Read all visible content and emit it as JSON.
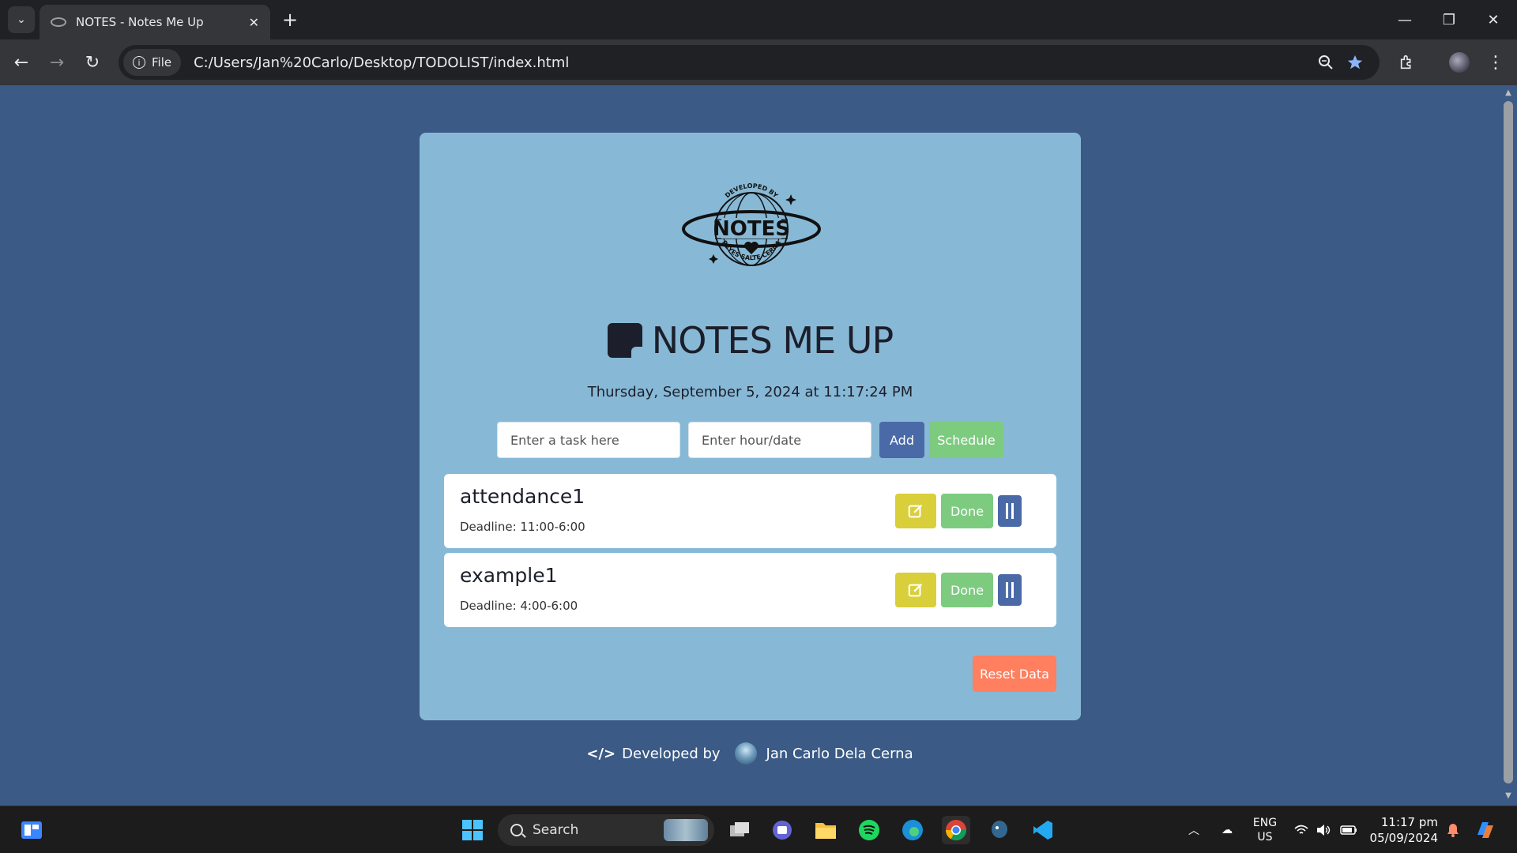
{
  "browser": {
    "tab_title": "NOTES - Notes Me Up",
    "tab_close": "✕",
    "new_tab": "+",
    "chip_label": "File",
    "url": "C:/Users/Jan%20Carlo/Desktop/TODOLIST/index.html"
  },
  "window_controls": {
    "minimize": "—",
    "restore": "❐",
    "close": "✕"
  },
  "nav": {
    "back": "←",
    "forward": "→",
    "reload": "↻"
  },
  "app": {
    "title": "NOTES ME UP",
    "datetime": "Thursday, September 5, 2024 at 11:17:24 PM",
    "task_placeholder": "Enter a task here",
    "date_placeholder": "Enter hour/date",
    "add_label": "Add",
    "schedule_label": "Schedule",
    "tasks": [
      {
        "name": "attendance1",
        "deadline": "Deadline: 11:00-6:00",
        "done_label": "Done"
      },
      {
        "name": "example1",
        "deadline": "Deadline: 4:00-6:00",
        "done_label": "Done"
      }
    ],
    "reset_label": "Reset Data",
    "footer_prefix": "Developed by",
    "footer_author": "Jan Carlo Dela Cerna",
    "logo_text": "NOTES",
    "logo_top_arc": "DEVELOPED BY",
    "logo_bottom_arc": "REYES SALTE CERNA"
  },
  "taskbar": {
    "search_label": "Search",
    "lang_top": "ENG",
    "lang_bottom": "US",
    "time": "11:17 pm",
    "date": "05/09/2024"
  },
  "colors": {
    "page_bg": "#3b5a85",
    "card_bg": "#87b9d6",
    "add": "#4a6aa7",
    "schedule": "#7dcb7f",
    "edit": "#d9cf3b",
    "reset": "#ff7f5f"
  },
  "icons": [
    "tab-list-icon",
    "favicon-icon",
    "info-icon",
    "zoom-icon",
    "star-icon",
    "extensions-icon",
    "profile-icon",
    "menu-icon",
    "note-icon",
    "edit-icon",
    "pause-icon",
    "code-icon",
    "windows-start-icon",
    "search-icon",
    "wifi-icon",
    "volume-icon",
    "battery-icon",
    "bell-icon"
  ]
}
